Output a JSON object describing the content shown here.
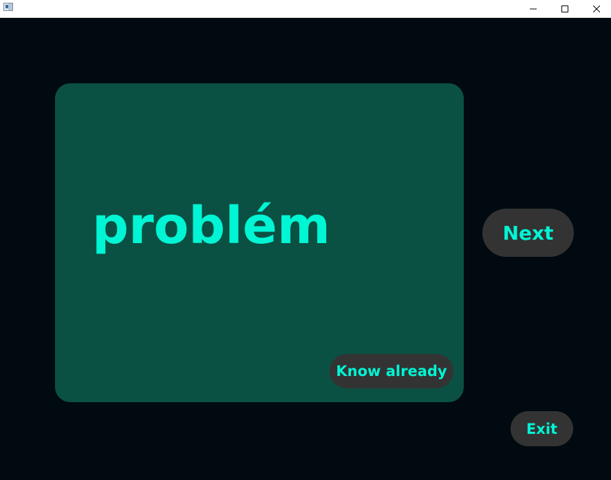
{
  "window": {
    "controls": {
      "minimize_icon": "minimize-icon",
      "maximize_icon": "maximize-icon",
      "close_icon": "close-icon"
    }
  },
  "card": {
    "word": "problém",
    "know_already_label": "Know already"
  },
  "actions": {
    "next_label": "Next",
    "exit_label": "Exit"
  },
  "colors": {
    "background": "#000a10",
    "card": "#0b5143",
    "accent_text": "#00f5d4",
    "button": "#333333"
  }
}
